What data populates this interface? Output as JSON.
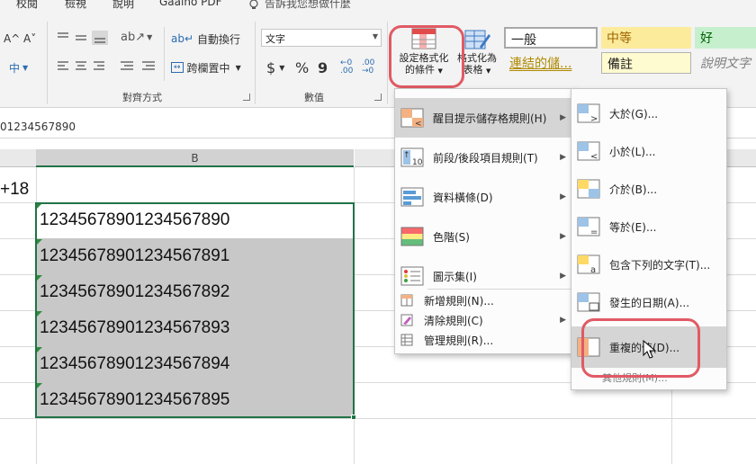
{
  "tabs": [
    "校閱",
    "檢視",
    "說明",
    "Gaaiho PDF"
  ],
  "tell_me": "告訴我您想做什麼",
  "ribbon": {
    "font_size_up": "A^",
    "font_size_down": "A˅",
    "phonetic": "中",
    "wrap_text": "自動換行",
    "merge_center": "跨欄置中",
    "alignment_group": "對齊方式",
    "number_format": "文字",
    "currency": "$",
    "percent": "%",
    "comma": "9",
    "number_group": "數值",
    "conditional_formatting": [
      "設定格式化",
      "的條件"
    ],
    "format_as_table": [
      "格式化為",
      "表格"
    ],
    "styles": [
      {
        "label": "一般",
        "bg": "#ffffff",
        "fg": "#222222"
      },
      {
        "label": "中等",
        "bg": "#fdeb9c",
        "fg": "#9c6500"
      },
      {
        "label": "好",
        "bg": "#c6efce",
        "fg": "#006100"
      },
      {
        "label": "連結的儲...",
        "bg": "#f3f3f3",
        "fg": "#b08a00"
      },
      {
        "label": "備註",
        "bg": "#fffbd0",
        "fg": "#222222"
      },
      {
        "label": "說明文字",
        "bg": "#f3f3f3",
        "fg": "#7f7f7f"
      }
    ]
  },
  "formula_bar": {
    "text": "01234567890"
  },
  "sheet": {
    "column_b": "B",
    "a2_value": "+18",
    "cells": [
      "12345678901234567890",
      "12345678901234567891",
      "12345678901234567892",
      "12345678901234567893",
      "12345678901234567894",
      "12345678901234567895"
    ]
  },
  "cf_menu": {
    "items": [
      {
        "label": "醒目提示儲存格規則(H)",
        "icon": "highlight-cells-rules-icon",
        "submenu": true
      },
      {
        "label": "前段/後段項目規則(T)",
        "icon": "top-bottom-rules-icon",
        "submenu": true
      },
      {
        "label": "資料橫條(D)",
        "icon": "data-bars-icon",
        "submenu": true
      },
      {
        "label": "色階(S)",
        "icon": "color-scales-icon",
        "submenu": true
      },
      {
        "label": "圖示集(I)",
        "icon": "icon-sets-icon",
        "submenu": true
      }
    ],
    "small_items": [
      {
        "label": "新增規則(N)...",
        "icon": "new-rule-icon"
      },
      {
        "label": "清除規則(C)",
        "icon": "clear-rules-icon",
        "submenu": true
      },
      {
        "label": "管理規則(R)...",
        "icon": "manage-rules-icon"
      }
    ]
  },
  "sub_menu": {
    "items": [
      {
        "label": "大於(G)...",
        "icon": "greater-than-icon"
      },
      {
        "label": "小於(L)...",
        "icon": "less-than-icon"
      },
      {
        "label": "介於(B)...",
        "icon": "between-icon"
      },
      {
        "label": "等於(E)...",
        "icon": "equal-to-icon"
      },
      {
        "label": "包含下列的文字(T)...",
        "icon": "text-contains-icon"
      },
      {
        "label": "發生的日期(A)...",
        "icon": "date-occurring-icon"
      },
      {
        "label": "重複的值(D)...",
        "icon": "duplicate-values-icon"
      }
    ],
    "more": "其他規則(M)..."
  },
  "colors": {
    "accent": "#e05a64",
    "excel_green": "#217346",
    "selection": "#c8c8c8"
  }
}
